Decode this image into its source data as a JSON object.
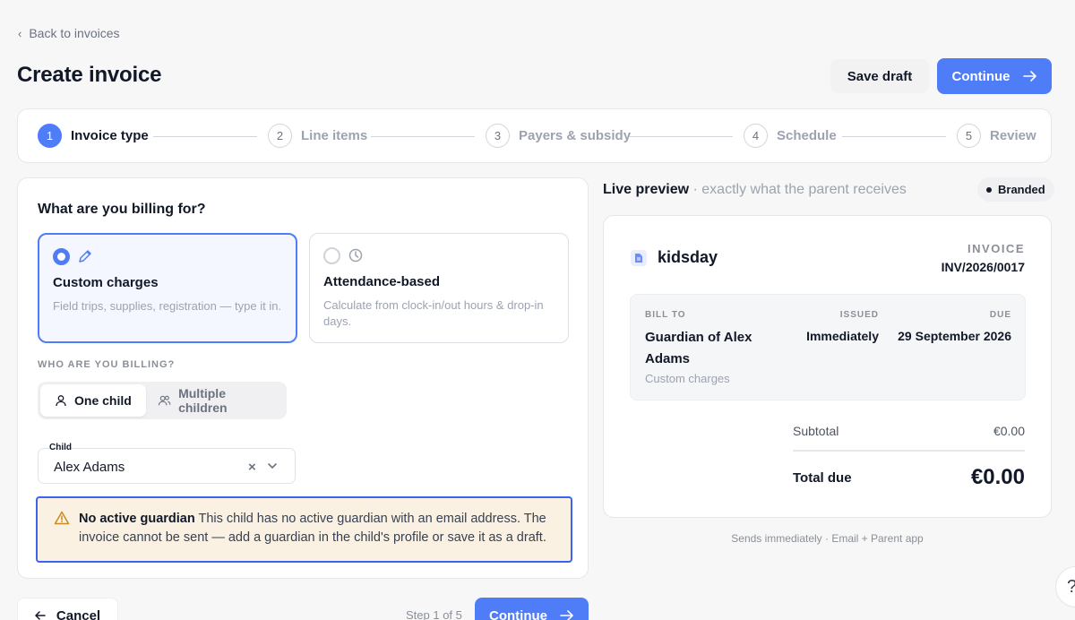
{
  "nav": {
    "back_label": "Back to invoices"
  },
  "header": {
    "title": "Create invoice",
    "save_label": "Save draft",
    "continue_label": "Continue"
  },
  "stepper": {
    "steps": [
      {
        "num": "1",
        "label": "Invoice type"
      },
      {
        "num": "2",
        "label": "Line items"
      },
      {
        "num": "3",
        "label": "Payers & subsidy"
      },
      {
        "num": "4",
        "label": "Schedule"
      },
      {
        "num": "5",
        "label": "Review"
      }
    ],
    "active_index": 0
  },
  "billing": {
    "question": "What are you billing for?",
    "options": [
      {
        "title": "Custom charges",
        "desc": "Field trips, supplies, registration — type it in.",
        "icon": "pencil-icon",
        "selected": true
      },
      {
        "title": "Attendance-based",
        "desc": "Calculate from clock-in/out hours & drop-in days.",
        "icon": "clock-icon",
        "selected": false
      }
    ]
  },
  "who": {
    "label": "WHO ARE YOU BILLING?",
    "one_child": "One child",
    "multiple_children": "Multiple children"
  },
  "child": {
    "label": "Child",
    "value": "Alex Adams",
    "clear": "×"
  },
  "alert": {
    "title": "No active guardian",
    "message": "This child has no active guardian with an email address. The invoice cannot be sent — add a guardian in the child's profile or save it as a draft."
  },
  "preview": {
    "heading": "Live preview",
    "subheading": "· exactly what the parent receives",
    "badge": "Branded",
    "brand_name": "kidsday",
    "invoice_label": "INVOICE",
    "invoice_number": "INV/2026/0017",
    "bill_to_label": "BILL TO",
    "bill_to_name": "Guardian of Alex Adams",
    "bill_to_sub": "Custom charges",
    "issued_label": "ISSUED",
    "issued_value": "Immediately",
    "due_label": "DUE",
    "due_value": "29 September 2026",
    "subtotal_label": "Subtotal",
    "subtotal_value": "€0.00",
    "total_label": "Total due",
    "total_value": "€0.00",
    "sends_note": "Sends immediately · Email + Parent app"
  },
  "footer": {
    "cancel_label": "Cancel",
    "step_text": "Step 1 of 5",
    "continue_label": "Continue"
  },
  "help": {
    "label": "?"
  },
  "colors": {
    "accent": "#4f7cf7",
    "alert_border": "#3b63f0",
    "alert_bg": "#fbf1e3"
  }
}
